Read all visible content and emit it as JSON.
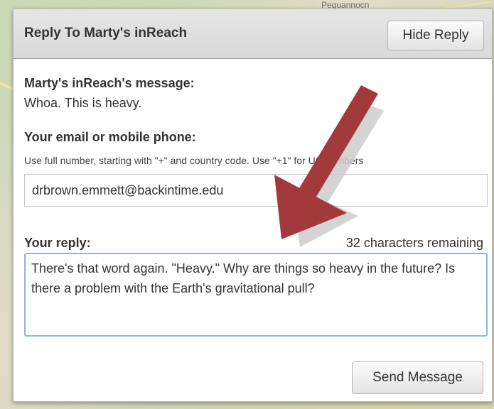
{
  "map": {
    "partial_label": "Peguannocn"
  },
  "dialog": {
    "title": "Reply To Marty's inReach",
    "hide_button": "Hide Reply",
    "message_label": "Marty's inReach's message:",
    "message_text": "Whoa. This is heavy.",
    "contact_label": "Your email or mobile phone:",
    "contact_hint": "Use full number, starting with \"+\" and country code. Use \"+1\" for US numbers",
    "contact_value": "drbrown.emmett@backintime.edu",
    "reply_label": "Your reply:",
    "chars_remaining": "32 characters remaining",
    "reply_value": "There's that word again. \"Heavy.\" Why are things so heavy in the future? Is there a problem with the Earth's gravitational pull?",
    "send_button": "Send Message"
  },
  "colors": {
    "arrow_primary": "#a23a3c",
    "arrow_shadow": "#cdcdcd",
    "focus_border": "#8fb6e2"
  }
}
